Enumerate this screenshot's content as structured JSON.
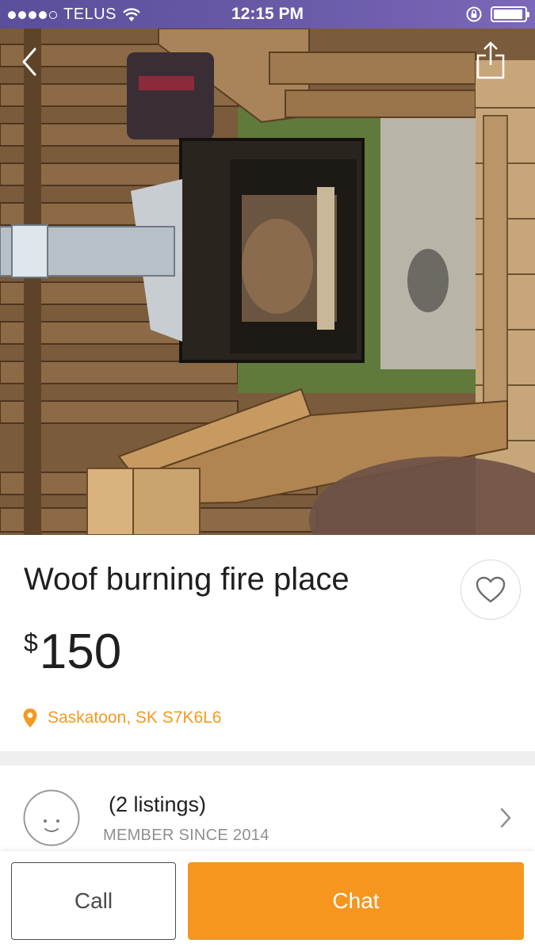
{
  "status_bar": {
    "carrier": "TELUS",
    "time": "12:15 PM",
    "signal_dots_filled": 4,
    "signal_dots_total": 5,
    "battery_level": 0.95
  },
  "photo": {
    "back_icon": "chevron-left-icon",
    "share_icon": "share-icon"
  },
  "listing": {
    "title": "Woof burning fire place",
    "currency": "$",
    "price": "150",
    "location": "Saskatoon, SK  S7K6L6",
    "favorite_icon": "heart-outline-icon"
  },
  "seller": {
    "listings": "(2 listings)",
    "member_since": "MEMBER SINCE 2014"
  },
  "actions": {
    "call_label": "Call",
    "chat_label": "Chat"
  },
  "colors": {
    "accent": "#f6961e",
    "location": "#f39a1f",
    "status_bar": "#6a5aa8",
    "text": "#1f1f1f",
    "muted": "#8f8f8f"
  }
}
